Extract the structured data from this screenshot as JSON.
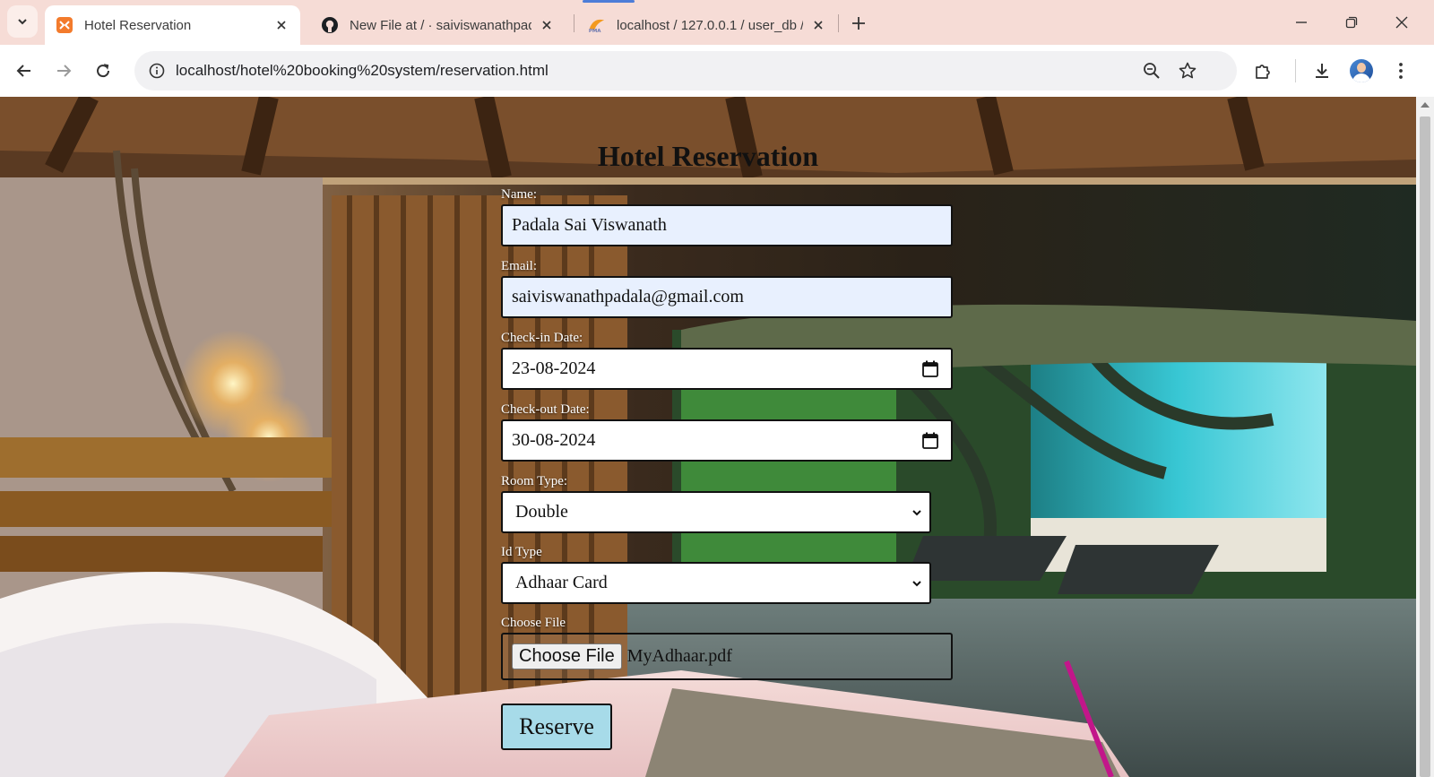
{
  "browser": {
    "tabs": [
      {
        "title": "Hotel Reservation",
        "favicon": "xampp-icon",
        "active": true
      },
      {
        "title": "New File at / · saiviswanathpada",
        "favicon": "github-icon",
        "active": false
      },
      {
        "title": "localhost / 127.0.0.1 / user_db /",
        "favicon": "phpmyadmin-icon",
        "active": false
      }
    ],
    "url": "localhost/hotel%20booking%20system/reservation.html"
  },
  "page": {
    "title": "Hotel Reservation",
    "form": {
      "name_label": "Name:",
      "name_value": "Padala Sai Viswanath",
      "email_label": "Email:",
      "email_value": "saiviswanathpadala@gmail.com",
      "checkin_label": "Check-in Date:",
      "checkin_value": "23-08-2024",
      "checkout_label": "Check-out Date:",
      "checkout_value": "30-08-2024",
      "room_type_label": "Room Type:",
      "room_type_value": "Double",
      "id_type_label": "Id Type",
      "id_type_value": "Adhaar Card",
      "file_label": "Choose File",
      "file_button": "Choose File",
      "file_name": "MyAdhaar.pdf",
      "submit_label": "Reserve"
    }
  },
  "colors": {
    "tabstrip": "#f6dcd6",
    "autofill": "#e8f0fe",
    "reserve_button": "#a7dbe9"
  }
}
